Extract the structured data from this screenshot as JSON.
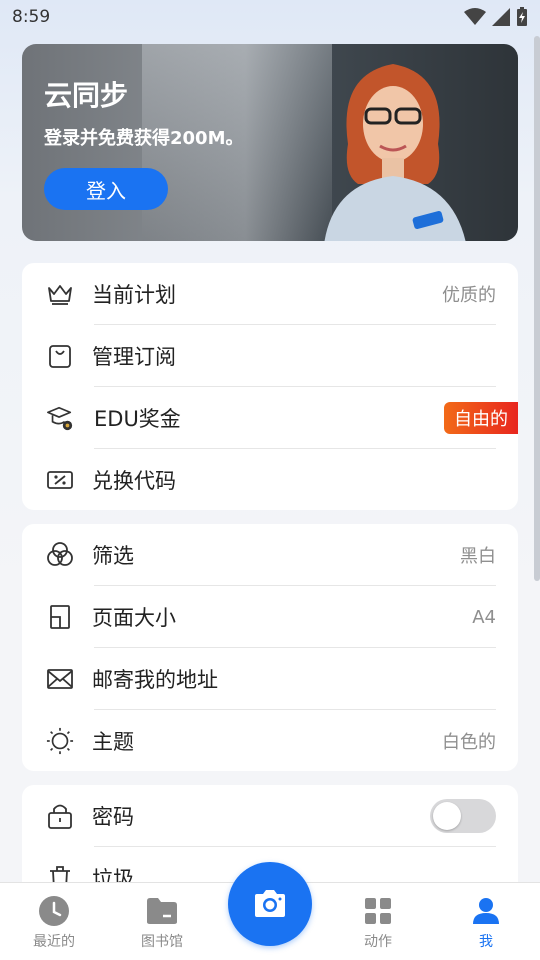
{
  "status_bar": {
    "time": "8:59"
  },
  "banner": {
    "title": "云同步",
    "subtitle": "登录并免费获得200M。",
    "login_label": "登入"
  },
  "section1": [
    {
      "label": "当前计划",
      "value": "优质的",
      "icon": "crown-icon"
    },
    {
      "label": "管理订阅",
      "value": "",
      "icon": "shopping-bag-icon"
    },
    {
      "label": "EDU奖金",
      "badge": "自由的",
      "icon": "graduation-cap-icon"
    },
    {
      "label": "兑换代码",
      "value": "",
      "icon": "coupon-icon"
    }
  ],
  "section2": [
    {
      "label": "筛选",
      "value": "黑白",
      "icon": "filter-icon"
    },
    {
      "label": "页面大小",
      "value": "A4",
      "icon": "page-size-icon"
    },
    {
      "label": "邮寄我的地址",
      "value": "",
      "icon": "mail-icon"
    },
    {
      "label": "主题",
      "value": "白色的",
      "icon": "sun-icon"
    }
  ],
  "section3": [
    {
      "label": "密码",
      "toggle": false,
      "icon": "lock-icon"
    },
    {
      "label": "垃圾",
      "icon": "trash-icon"
    }
  ],
  "bottom_nav": [
    {
      "label": "最近的",
      "icon": "clock-icon"
    },
    {
      "label": "图书馆",
      "icon": "folder-icon"
    },
    {
      "label": "动作",
      "icon": "grid-icon"
    },
    {
      "label": "我",
      "icon": "person-icon",
      "active": true
    }
  ],
  "colors": {
    "accent": "#1a73f2",
    "badge_start": "#f26a18",
    "badge_end": "#e8261e"
  }
}
